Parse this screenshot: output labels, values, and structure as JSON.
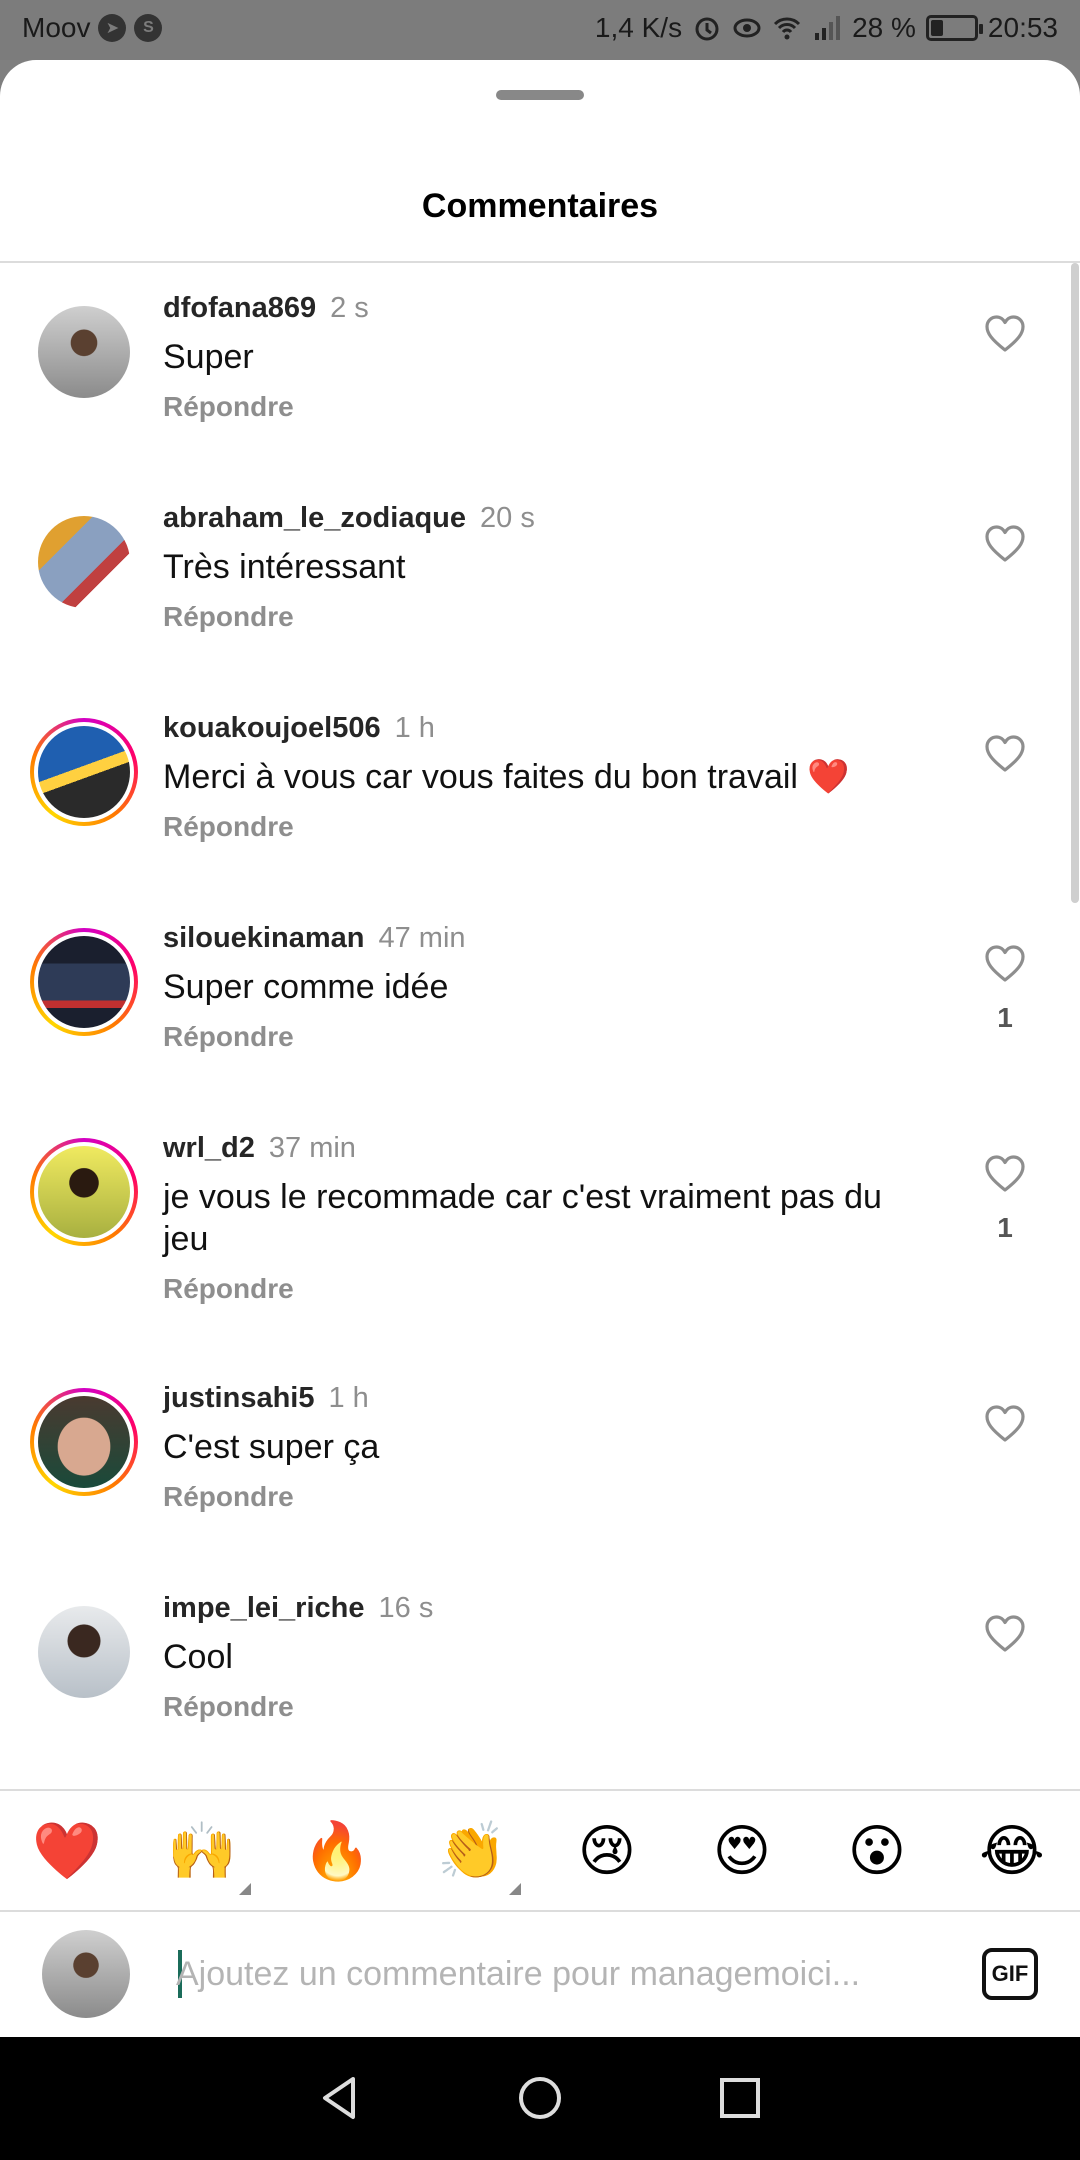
{
  "status_bar": {
    "carrier": "Moov",
    "network_speed": "1,4 K/s",
    "battery_percent": "28 %",
    "battery_level": 0.28,
    "time": "20:53",
    "app_icons": [
      "telegram-icon",
      "s-app-icon"
    ],
    "indicator_icons": [
      "alarm-icon",
      "eye-icon",
      "wifi-icon",
      "signal-icon",
      "battery-icon"
    ]
  },
  "sheet": {
    "title": "Commentaires"
  },
  "comments": [
    {
      "username": "dfofana869",
      "time": "2 s",
      "text": "Super",
      "reply_label": "Répondre",
      "likes": "",
      "has_story_ring": false
    },
    {
      "username": "abraham_le_zodiaque",
      "time": "20 s",
      "text": "Très intéressant",
      "reply_label": "Répondre",
      "likes": "",
      "has_story_ring": false
    },
    {
      "username": "kouakoujoel506",
      "time": "1 h",
      "text": "Merci à vous car vous faites du bon travail ❤️",
      "reply_label": "Répondre",
      "likes": "",
      "has_story_ring": true
    },
    {
      "username": "silouekinaman",
      "time": "47 min",
      "text": "Super comme idée",
      "reply_label": "Répondre",
      "likes": "1",
      "has_story_ring": true
    },
    {
      "username": "wrl_d2",
      "time": "37 min",
      "text": "je vous le recommade car c'est vraiment pas du jeu",
      "reply_label": "Répondre",
      "likes": "1",
      "has_story_ring": true
    },
    {
      "username": "justinsahi5",
      "time": "1 h",
      "text": "C'est super ça",
      "reply_label": "Répondre",
      "likes": "",
      "has_story_ring": true
    },
    {
      "username": "impe_lei_riche",
      "time": "16 s",
      "text": "Cool",
      "reply_label": "Répondre",
      "likes": "",
      "has_story_ring": false
    }
  ],
  "emoji_reactions": [
    "❤️",
    "🙌",
    "🔥",
    "👏",
    "😢",
    "😍",
    "😮",
    "😂"
  ],
  "composer": {
    "placeholder": "Ajoutez un commentaire pour managemoici...",
    "value": "",
    "gif_label": "GIF"
  },
  "nav": {
    "icons": [
      "back-icon",
      "home-icon",
      "recents-icon"
    ]
  },
  "colors": {
    "username": "#262626",
    "secondary_text": "#8e8e8e",
    "story_ring": "#ff0069"
  }
}
